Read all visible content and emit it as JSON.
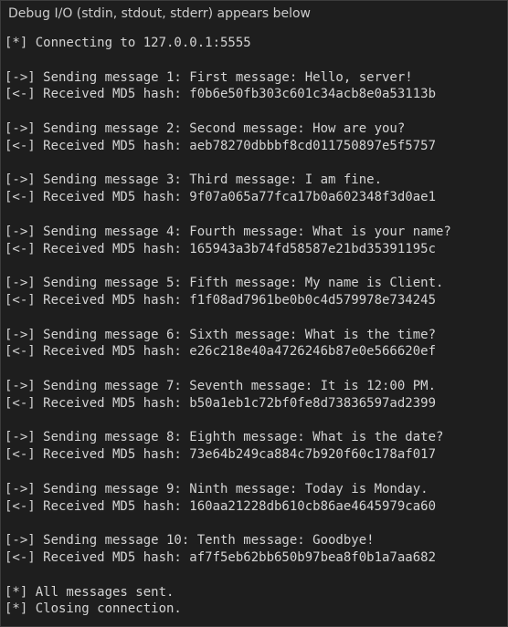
{
  "panel": {
    "title": "Debug I/O (stdin, stdout, stderr) appears below"
  },
  "output": {
    "lines": [
      "[*] Connecting to 127.0.0.1:5555",
      "",
      "[->] Sending message 1: First message: Hello, server!",
      "[<-] Received MD5 hash: f0b6e50fb303c601c34acb8e0a53113b",
      "",
      "[->] Sending message 2: Second message: How are you?",
      "[<-] Received MD5 hash: aeb78270dbbbf8cd011750897e5f5757",
      "",
      "[->] Sending message 3: Third message: I am fine.",
      "[<-] Received MD5 hash: 9f07a065a77fca17b0a602348f3d0ae1",
      "",
      "[->] Sending message 4: Fourth message: What is your name?",
      "[<-] Received MD5 hash: 165943a3b74fd58587e21bd35391195c",
      "",
      "[->] Sending message 5: Fifth message: My name is Client.",
      "[<-] Received MD5 hash: f1f08ad7961be0b0c4d579978e734245",
      "",
      "[->] Sending message 6: Sixth message: What is the time?",
      "[<-] Received MD5 hash: e26c218e40a4726246b87e0e566620ef",
      "",
      "[->] Sending message 7: Seventh message: It is 12:00 PM.",
      "[<-] Received MD5 hash: b50a1eb1c72bf0fe8d73836597ad2399",
      "",
      "[->] Sending message 8: Eighth message: What is the date?",
      "[<-] Received MD5 hash: 73e64b249ca884c7b920f60c178af017",
      "",
      "[->] Sending message 9: Ninth message: Today is Monday.",
      "[<-] Received MD5 hash: 160aa21228db610cb86ae4645979ca60",
      "",
      "[->] Sending message 10: Tenth message: Goodbye!",
      "[<-] Received MD5 hash: af7f5eb62bb650b97bea8f0b1a7aa682",
      "",
      "[*] All messages sent.",
      "[*] Closing connection."
    ]
  }
}
